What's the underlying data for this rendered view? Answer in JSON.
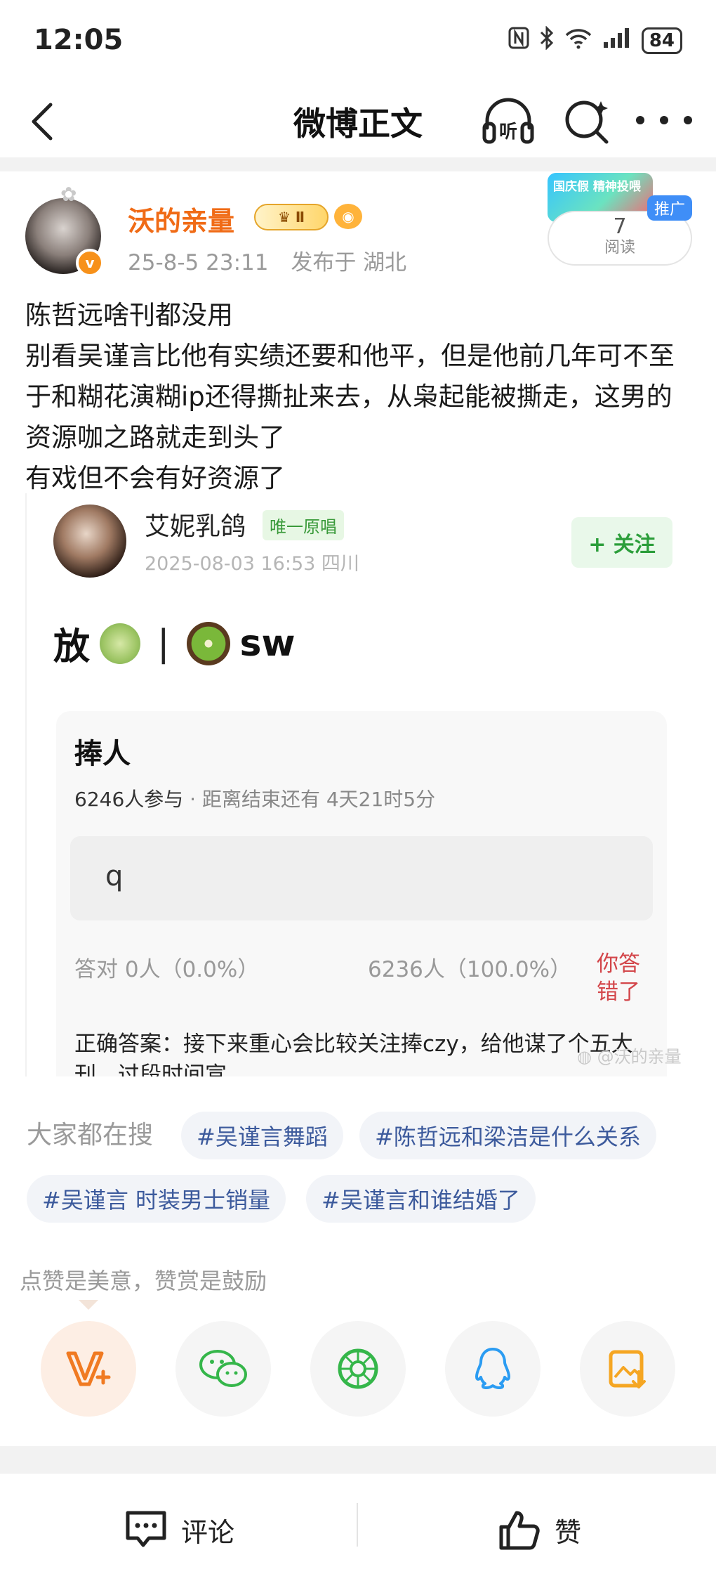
{
  "status_bar": {
    "time": "12:05",
    "battery": "84"
  },
  "nav": {
    "title": "微博正文",
    "listen_label": "听"
  },
  "post": {
    "author_name": "沃的亲量",
    "vip_level": "Ⅱ",
    "timestamp": "25-8-5 23:11",
    "location": "发布于 湖北",
    "promo_tag": "推广",
    "promo_art_text": "国庆假 精神投喂",
    "read_count": "7",
    "read_label": "阅读",
    "text_lines": [
      "陈哲远啥刊都没用",
      "别看吴谨言比他有实绩还要和他平，但是他前几年可不至于和糊花演糊ip还得撕扯来去，从枭起能被撕走，这男的资源咖之路就走到头了",
      "有戏但不会有好资源了"
    ]
  },
  "embed": {
    "name": "艾妮乳鸽",
    "badge": "唯一原唱",
    "meta": "2025-08-03 16:53  四川",
    "follow_label": "+ 关注",
    "headline_prefix": "放",
    "headline_sep": "|",
    "headline_suffix": "sw",
    "quiz": {
      "title": "捧人",
      "participants": "6246人参与",
      "deadline": " · 距离结束还有 4天21时5分",
      "option": "q",
      "correct_stat": "答对  0人（0.0%）",
      "wrong_stat": "6236人（100.0%）",
      "you_wrong": "你答错了",
      "answer": "正确答案：接下来重心会比较关注捧czy，给他谋了个五大刊，过段时间宣"
    },
    "watermark": "@沃的亲量"
  },
  "hot_search": {
    "label": "大家都在搜",
    "tags": [
      "#吴谨言舞蹈",
      "#陈哲远和梁洁是什么关系",
      "#吴谨言 时装男士销量",
      "#吴谨言和谁结婚了"
    ]
  },
  "reward": {
    "hint": "点赞是美意，赞赏是鼓励"
  },
  "bottom_bar": {
    "comment_label": "评论",
    "like_label": "赞"
  },
  "colors": {
    "author_orange": "#f06b16",
    "tag_text": "#3c5a9c",
    "follow_green": "#2c9e3b",
    "wrong_red": "#d3464a"
  }
}
